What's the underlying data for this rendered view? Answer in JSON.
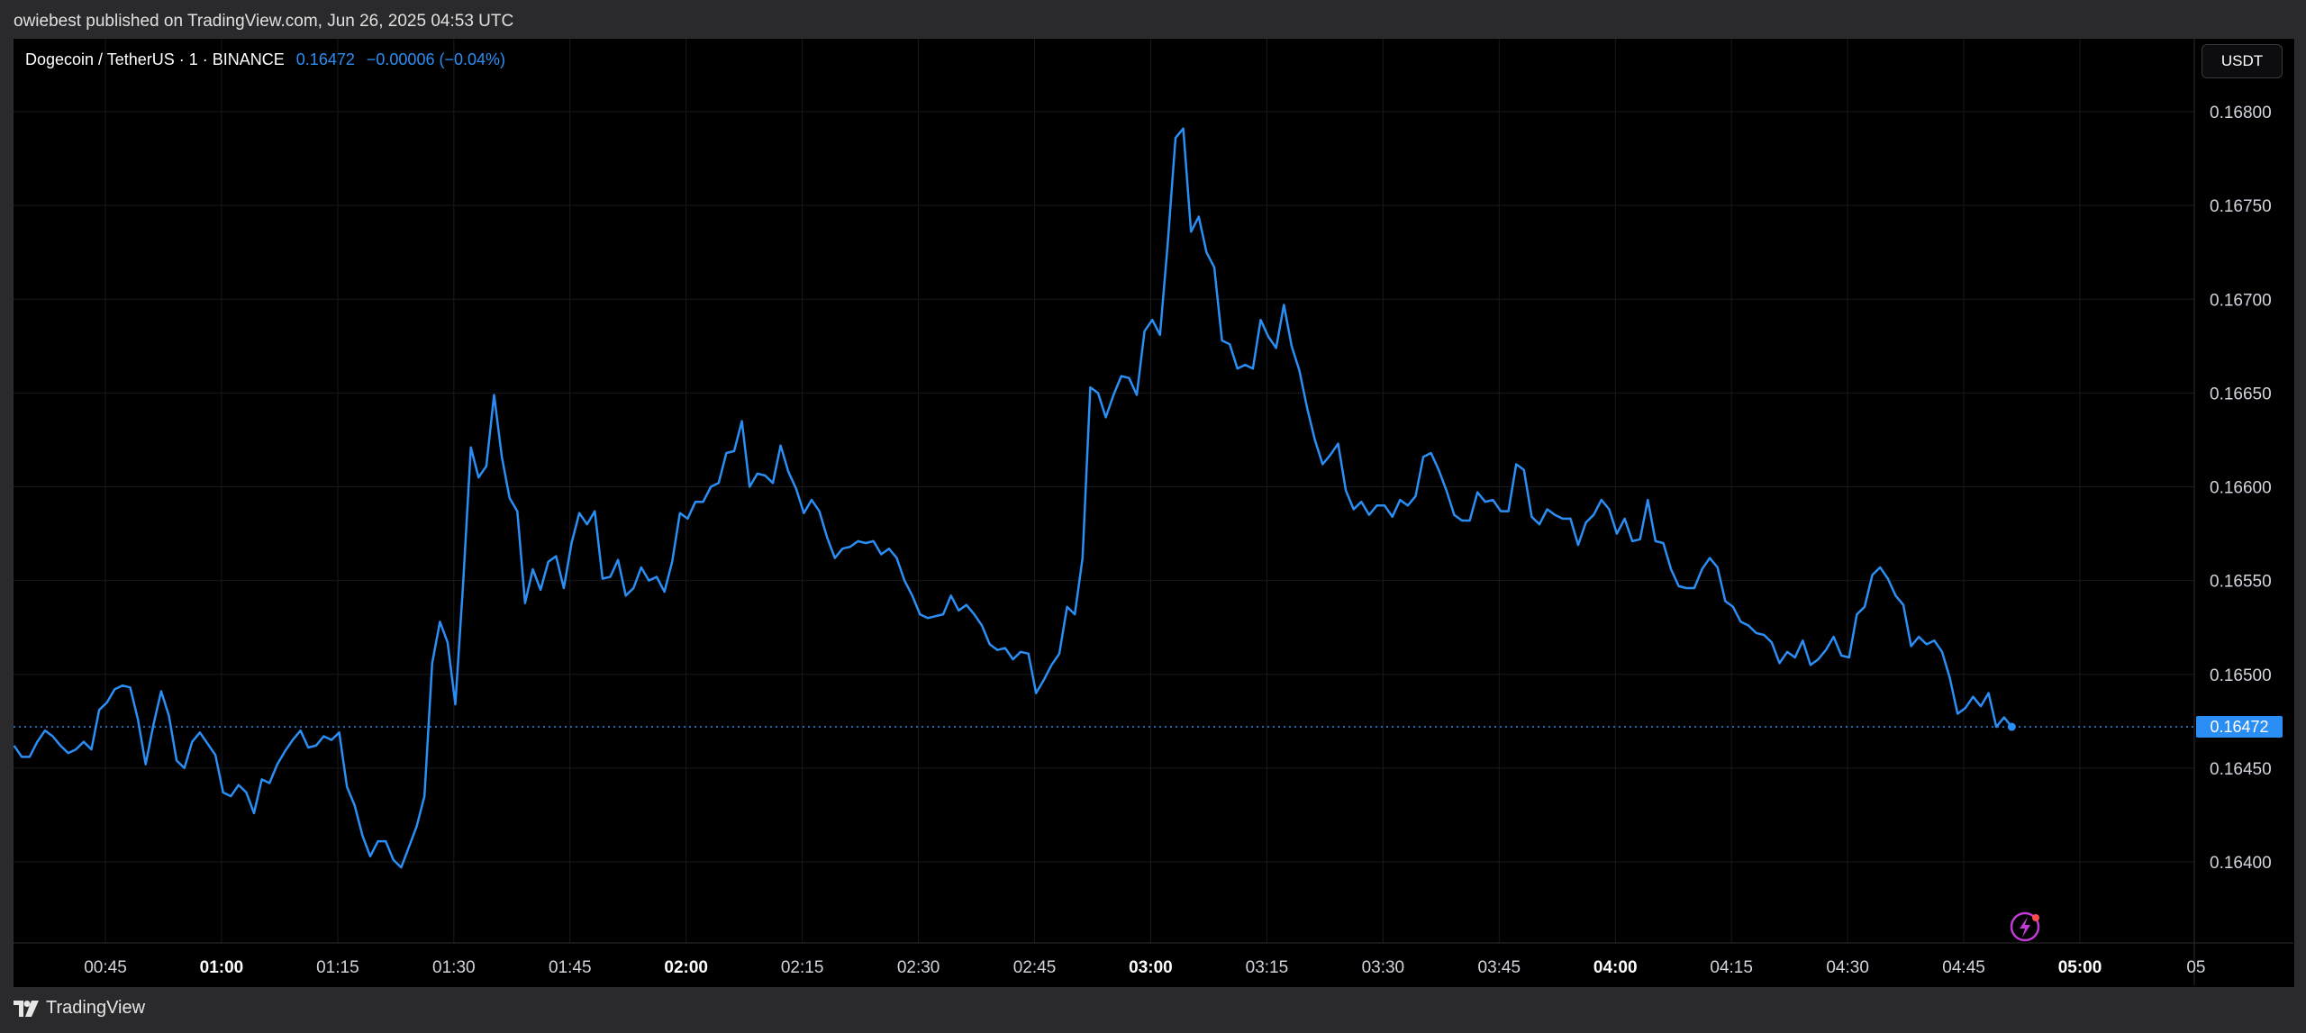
{
  "publish_info": "owiebest published on TradingView.com, Jun 26, 2025 04:53 UTC",
  "symbol": {
    "name": "Dogecoin / TetherUS · 1 · BINANCE",
    "price": "0.16472",
    "change": "−0.00006 (−0.04%)"
  },
  "currency_button": "USDT",
  "last_price_tag": "0.16472",
  "brand": "TradingView",
  "colors": {
    "line": "#2b8ef5",
    "background": "#000000",
    "grid": "#1a1a1c",
    "price_tag_bg": "#2b8ef5",
    "logo_icon": "#9b3bd6"
  },
  "chart_data": {
    "type": "line",
    "title": "Dogecoin / TetherUS · 1 · BINANCE",
    "xlabel": "",
    "ylabel": "",
    "ylim": [
      0.16355,
      0.16855
    ],
    "grid": true,
    "y_ticks": [
      "0.16400",
      "0.16450",
      "0.16500",
      "0.16550",
      "0.16600",
      "0.16650",
      "0.16700",
      "0.16750",
      "0.16800"
    ],
    "x_ticks": [
      {
        "label": "00:45",
        "minute": 45,
        "bold": false
      },
      {
        "label": "01:00",
        "minute": 60,
        "bold": true
      },
      {
        "label": "01:15",
        "minute": 75,
        "bold": false
      },
      {
        "label": "01:30",
        "minute": 90,
        "bold": false
      },
      {
        "label": "01:45",
        "minute": 105,
        "bold": false
      },
      {
        "label": "02:00",
        "minute": 120,
        "bold": true
      },
      {
        "label": "02:15",
        "minute": 135,
        "bold": false
      },
      {
        "label": "02:30",
        "minute": 150,
        "bold": false
      },
      {
        "label": "02:45",
        "minute": 165,
        "bold": false
      },
      {
        "label": "03:00",
        "minute": 180,
        "bold": true
      },
      {
        "label": "03:15",
        "minute": 195,
        "bold": false
      },
      {
        "label": "03:30",
        "minute": 210,
        "bold": false
      },
      {
        "label": "03:45",
        "minute": 225,
        "bold": false
      },
      {
        "label": "04:00",
        "minute": 240,
        "bold": true
      },
      {
        "label": "04:15",
        "minute": 255,
        "bold": false
      },
      {
        "label": "04:30",
        "minute": 270,
        "bold": false
      },
      {
        "label": "04:45",
        "minute": 285,
        "bold": false
      },
      {
        "label": "05:00",
        "minute": 300,
        "bold": true
      },
      {
        "label": "05",
        "minute": 315,
        "bold": false
      }
    ],
    "x_range_minutes": [
      33.2,
      314.5
    ],
    "last_value": 0.16472,
    "series": [
      {
        "x_start_minute": 33.2,
        "x_step_minutes": 1,
        "values": [
          0.16462,
          0.16456,
          0.16456,
          0.16464,
          0.1647,
          0.16467,
          0.16462,
          0.16458,
          0.1646,
          0.16464,
          0.1646,
          0.16481,
          0.16485,
          0.16492,
          0.16494,
          0.16493,
          0.16476,
          0.16452,
          0.16473,
          0.16491,
          0.16478,
          0.16454,
          0.1645,
          0.16464,
          0.16469,
          0.16463,
          0.16457,
          0.16437,
          0.16435,
          0.16441,
          0.16437,
          0.16426,
          0.16444,
          0.16442,
          0.16452,
          0.16459,
          0.16465,
          0.1647,
          0.16461,
          0.16462,
          0.16467,
          0.16465,
          0.16469,
          0.1644,
          0.1643,
          0.16414,
          0.16403,
          0.16411,
          0.16411,
          0.16401,
          0.16397,
          0.16408,
          0.16419,
          0.16435,
          0.16506,
          0.16528,
          0.16517,
          0.16484,
          0.16548,
          0.16621,
          0.16605,
          0.16611,
          0.16649,
          0.16616,
          0.16594,
          0.16587,
          0.16538,
          0.16556,
          0.16545,
          0.1656,
          0.16563,
          0.16546,
          0.1657,
          0.16586,
          0.1658,
          0.16587,
          0.16551,
          0.16552,
          0.16561,
          0.16542,
          0.16546,
          0.16557,
          0.1655,
          0.16552,
          0.16544,
          0.1656,
          0.16586,
          0.16583,
          0.16592,
          0.16592,
          0.166,
          0.16602,
          0.16618,
          0.16619,
          0.16635,
          0.166,
          0.16607,
          0.16606,
          0.16602,
          0.16622,
          0.16608,
          0.16599,
          0.16586,
          0.16593,
          0.16587,
          0.16573,
          0.16562,
          0.16567,
          0.16568,
          0.16571,
          0.1657,
          0.16571,
          0.16564,
          0.16567,
          0.16562,
          0.1655,
          0.16542,
          0.16532,
          0.1653,
          0.16531,
          0.16532,
          0.16542,
          0.16534,
          0.16537,
          0.16532,
          0.16526,
          0.16516,
          0.16513,
          0.16514,
          0.16508,
          0.16512,
          0.16511,
          0.1649,
          0.16497,
          0.16505,
          0.16511,
          0.16536,
          0.16532,
          0.16562,
          0.16653,
          0.1665,
          0.16637,
          0.16649,
          0.16659,
          0.16658,
          0.16649,
          0.16683,
          0.16689,
          0.16681,
          0.1673,
          0.16786,
          0.16791,
          0.16736,
          0.16744,
          0.16725,
          0.16717,
          0.16678,
          0.16676,
          0.16663,
          0.16665,
          0.16663,
          0.16689,
          0.1668,
          0.16674,
          0.16697,
          0.16675,
          0.16662,
          0.16642,
          0.16625,
          0.16612,
          0.16617,
          0.16623,
          0.16598,
          0.16588,
          0.16592,
          0.16585,
          0.1659,
          0.1659,
          0.16584,
          0.16593,
          0.1659,
          0.16595,
          0.16616,
          0.16618,
          0.16609,
          0.16598,
          0.16585,
          0.16582,
          0.16582,
          0.16597,
          0.16592,
          0.16593,
          0.16587,
          0.16587,
          0.16612,
          0.16609,
          0.16584,
          0.1658,
          0.16588,
          0.16585,
          0.16583,
          0.16583,
          0.16569,
          0.16581,
          0.16585,
          0.16593,
          0.16588,
          0.16575,
          0.16583,
          0.16571,
          0.16572,
          0.16593,
          0.16571,
          0.1657,
          0.16556,
          0.16547,
          0.16546,
          0.16546,
          0.16556,
          0.16562,
          0.16557,
          0.16539,
          0.16536,
          0.16528,
          0.16526,
          0.16522,
          0.16521,
          0.16517,
          0.16506,
          0.16512,
          0.16509,
          0.16518,
          0.16505,
          0.16508,
          0.16513,
          0.1652,
          0.1651,
          0.16509,
          0.16532,
          0.16536,
          0.16553,
          0.16557,
          0.16551,
          0.16542,
          0.16537,
          0.16515,
          0.1652,
          0.16516,
          0.16518,
          0.16512,
          0.16498,
          0.16479,
          0.16482,
          0.16488,
          0.16483,
          0.1649,
          0.16472,
          0.16477,
          0.16472
        ]
      }
    ]
  }
}
